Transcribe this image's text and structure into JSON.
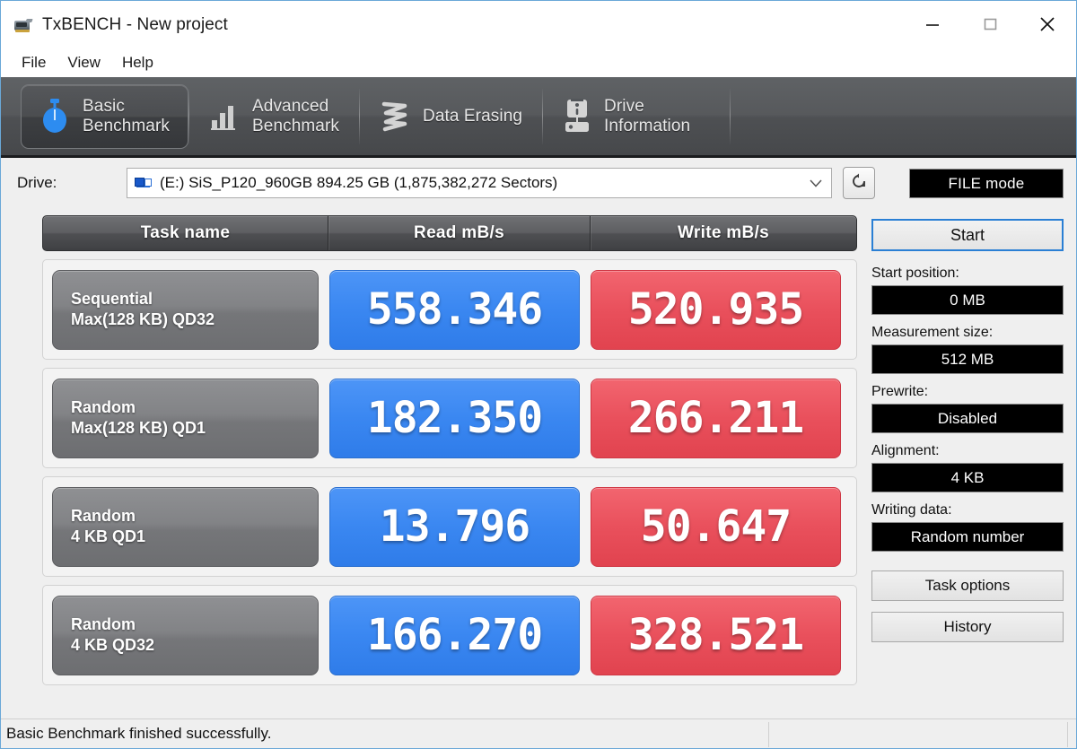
{
  "window": {
    "title": "TxBENCH - New project",
    "app_icon": "drive-benchmark-icon",
    "controls": {
      "minimize": "minimize-icon",
      "maximize": "maximize-icon",
      "close": "close-icon"
    }
  },
  "menu": {
    "items": [
      {
        "label": "File"
      },
      {
        "label": "View"
      },
      {
        "label": "Help"
      }
    ]
  },
  "tabs": [
    {
      "label": "Basic\nBenchmark",
      "icon": "stopwatch-icon",
      "active": true
    },
    {
      "label": "Advanced\nBenchmark",
      "icon": "bar-chart-icon",
      "active": false
    },
    {
      "label": "Data Erasing",
      "icon": "shredder-icon",
      "active": false
    },
    {
      "label": "Drive\nInformation",
      "icon": "hard-drive-info-icon",
      "active": false
    }
  ],
  "drive": {
    "label": "Drive:",
    "selected": "(E:) SiS_P120_960GB  894.25 GB (1,875,382,272 Sectors)",
    "icon": "drive-network-icon",
    "dropdown_arrow": "chevron-down-icon",
    "refresh_icon": "refresh-icon"
  },
  "mode_button": {
    "label": "FILE mode"
  },
  "table": {
    "headers": [
      "Task name",
      "Read mB/s",
      "Write mB/s"
    ],
    "rows": [
      {
        "task_line1": "Sequential",
        "task_line2": "Max(128 KB) QD32",
        "read": "558.346",
        "write": "520.935"
      },
      {
        "task_line1": "Random",
        "task_line2": "Max(128 KB) QD1",
        "read": "182.350",
        "write": "266.211"
      },
      {
        "task_line1": "Random",
        "task_line2": "4 KB QD1",
        "read": "13.796",
        "write": "50.647"
      },
      {
        "task_line1": "Random",
        "task_line2": "4 KB QD32",
        "read": "166.270",
        "write": "328.521"
      }
    ]
  },
  "sidepanel": {
    "start_label": "Start",
    "fields": [
      {
        "label": "Start position:",
        "value": "0 MB"
      },
      {
        "label": "Measurement size:",
        "value": "512 MB"
      },
      {
        "label": "Prewrite:",
        "value": "Disabled"
      },
      {
        "label": "Alignment:",
        "value": "4 KB"
      },
      {
        "label": "Writing data:",
        "value": "Random number"
      }
    ],
    "task_options_label": "Task options",
    "history_label": "History"
  },
  "statusbar": {
    "message": "Basic Benchmark finished successfully."
  },
  "colors": {
    "read_accent": "#3a87f1",
    "write_accent": "#e9505c",
    "tab_strip": "#53565a",
    "window_border": "#6aa8d8",
    "focus_blue": "#2a7fd4"
  }
}
